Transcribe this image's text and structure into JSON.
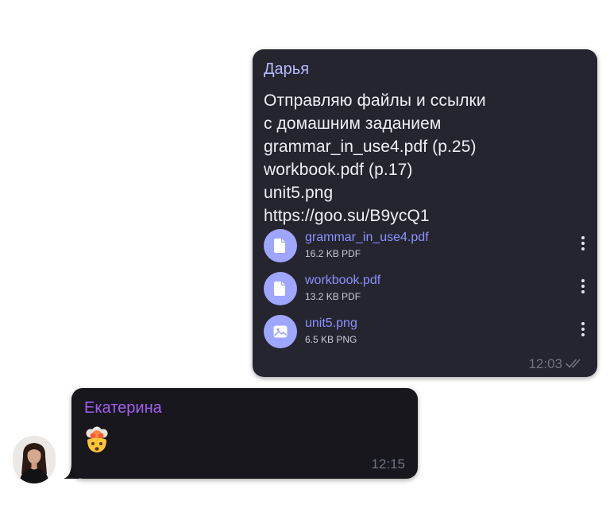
{
  "messages": [
    {
      "sender": "Дарья",
      "text_lines": [
        "Отправляю файлы и ссылки",
        "с домашним заданием",
        "grammar_in_use4.pdf (p.25)",
        "workbook.pdf (p.17)",
        "unit5.png",
        "https://goo.su/B9ycQ1"
      ],
      "attachments": [
        {
          "name": "grammar_in_use4.pdf",
          "meta": "16.2 KB PDF",
          "icon": "document-icon"
        },
        {
          "name": "workbook.pdf",
          "meta": "13.2 KB PDF",
          "icon": "document-icon"
        },
        {
          "name": "unit5.png",
          "meta": "6.5 KB PNG",
          "icon": "image-icon"
        }
      ],
      "time": "12:03",
      "status_icon": "double-check-icon"
    },
    {
      "sender": "Екатерина",
      "emoji": "exploding-head-emoji",
      "time": "12:15",
      "avatar_icon": "user-avatar"
    }
  ],
  "colors": {
    "outgoing_bubble": "#25252f",
    "incoming_bubble": "#17171d",
    "sender_out": "#b6b9ff",
    "sender_in": "#a45df2",
    "file_link": "#8c91ff",
    "file_icon_bg": "#9ea6ff",
    "timestamp": "#6f7383"
  }
}
